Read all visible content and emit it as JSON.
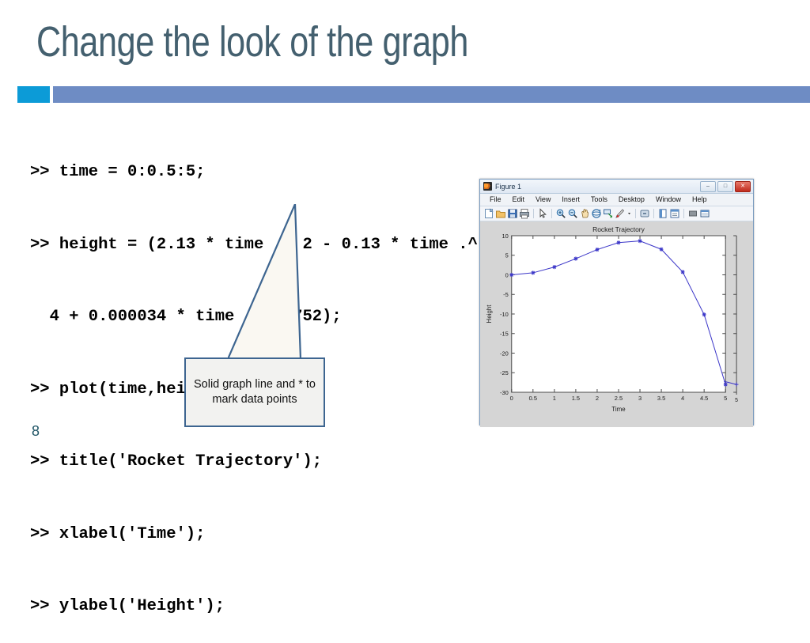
{
  "slide": {
    "title": "Change the look of the graph",
    "page_number": "8",
    "accent_color": "#0c9bd7",
    "bar_color": "#6e8cc4",
    "title_color": "#44606f"
  },
  "code": {
    "lines": [
      ">> time = 0:0.5:5;",
      ">> height = (2.13 * time .^ 2 - 0.13 * time .^",
      "  4 + 0.000034 * time .^ 4.752);",
      ">> plot(time,height,'*-');",
      ">> title('Rocket Trajectory');",
      ">> xlabel('Time');",
      ">> ylabel('Height');"
    ],
    "line4_prefix": ">> plot(time,height,'",
    "line4_highlight": "*-",
    "line4_suffix": "');",
    "highlight_color": "#e8262b"
  },
  "callout": {
    "text": "Solid graph line and * to mark data points",
    "border_color": "#3d6590",
    "fill_color": "#f2f2f0"
  },
  "figure_window": {
    "title": "Figure 1",
    "window_buttons": {
      "minimize": "–",
      "maximize": "□",
      "close": "✕"
    },
    "menus": [
      "File",
      "Edit",
      "View",
      "Insert",
      "Tools",
      "Desktop",
      "Window",
      "Help"
    ],
    "toolbar_icons": [
      "new-figure-icon",
      "open-file-icon",
      "save-figure-icon",
      "print-figure-icon",
      "edit-plot-pointer-icon",
      "zoom-in-icon",
      "zoom-out-icon",
      "pan-icon",
      "rotate-3d-icon",
      "data-cursor-icon",
      "brush-icon",
      "link-plot-icon",
      "figure-palette-icon",
      "plot-browser-icon",
      "property-editor-icon",
      "hide-plot-tools-icon",
      "show-plot-tools-icon"
    ]
  },
  "chart_data": {
    "type": "line",
    "title": "Rocket Trajectory",
    "xlabel": "Time",
    "ylabel": "Height",
    "xlim": [
      0,
      5
    ],
    "ylim": [
      -30,
      10
    ],
    "xticks": [
      "0",
      "0.5",
      "1",
      "1.5",
      "2",
      "2.5",
      "3",
      "3.5",
      "4",
      "4.5",
      "5"
    ],
    "xtick_values": [
      0,
      0.5,
      1,
      1.5,
      2,
      2.5,
      3,
      3.5,
      4,
      4.5,
      5
    ],
    "yticks": [
      "10",
      "5",
      "0",
      "-5",
      "-10",
      "-15",
      "-20",
      "-25",
      "-30"
    ],
    "ytick_values": [
      10,
      5,
      0,
      -5,
      -10,
      -15,
      -20,
      -25,
      -30
    ],
    "grid": false,
    "legend": null,
    "line_color": "#3b36c8",
    "marker": "*",
    "linestyle": "-",
    "series": [
      {
        "name": "height",
        "x": [
          0,
          0.5,
          1,
          1.5,
          2,
          2.5,
          3,
          3.5,
          4,
          4.5,
          5
        ],
        "values": [
          0,
          0.52,
          2.0,
          4.13,
          6.45,
          8.23,
          8.65,
          6.52,
          0.72,
          -10.15,
          -28.0
        ]
      }
    ]
  }
}
